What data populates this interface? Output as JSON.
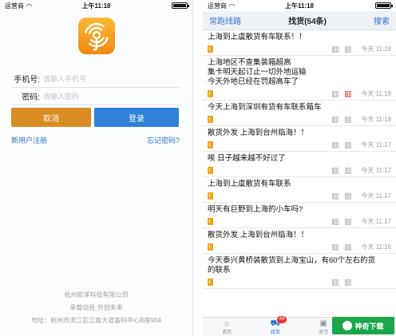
{
  "statusbar": {
    "carrier": "运营商",
    "time": "上午11:18"
  },
  "login": {
    "phone_label": "手机号:",
    "phone_placeholder": "请输入手机号",
    "password_label": "密码:",
    "password_placeholder": "请输入密码",
    "cancel_label": "取消",
    "login_label": "登录",
    "register_link": "新用户注册",
    "forgot_link": "忘记密码?",
    "footer": {
      "company": "杭州软洋科技有限公司",
      "slogan": "承载信任 共创未来",
      "address": "地址：杭州市滨江区江南大道荟科中心B座904"
    }
  },
  "freight": {
    "nav_left": "常跑线路",
    "title": "找货(54条)",
    "nav_right": "搜索",
    "items": [
      {
        "text": "上海到上虞散货有车联系！！",
        "date": "今天 11:18",
        "highlight": false
      },
      {
        "text": "上海地区不查集装箱超高\n集卡明天起订止一切外地运输\n今天外地已经在罚超高车了",
        "date": "今天 11:18",
        "highlight": true
      },
      {
        "text": "今天上海到深圳有货有车联系箱车",
        "date": "今天 11:18",
        "highlight": false
      },
      {
        "text": "散货外发 上海到台州临海！！",
        "date": "今天 11:17",
        "highlight": false
      },
      {
        "text": "唉   日子越来越不好过了",
        "date": "今天 11:17",
        "highlight": false
      },
      {
        "text": "上海到上虞散货有车联系",
        "date": "今天 11:17",
        "highlight": false
      },
      {
        "text": "明天有巨野到上海的小车吗?",
        "date": "今天 11:17",
        "highlight": false
      },
      {
        "text": "散货外发 上海到台州临海！！",
        "date": "今天 11:16",
        "highlight": false
      },
      {
        "text": "今天泰兴黄桥装散货到上海宝山，有60个左右的货\n的联系",
        "date": "",
        "highlight": false
      }
    ],
    "tabs": [
      {
        "label": "首页",
        "icon": "⌂"
      },
      {
        "label": "找货",
        "icon": "⛟",
        "badge": "44"
      },
      {
        "label": "发货",
        "icon": "▣"
      },
      {
        "label": "",
        "icon": ""
      }
    ],
    "watermark": "神奇下载"
  }
}
